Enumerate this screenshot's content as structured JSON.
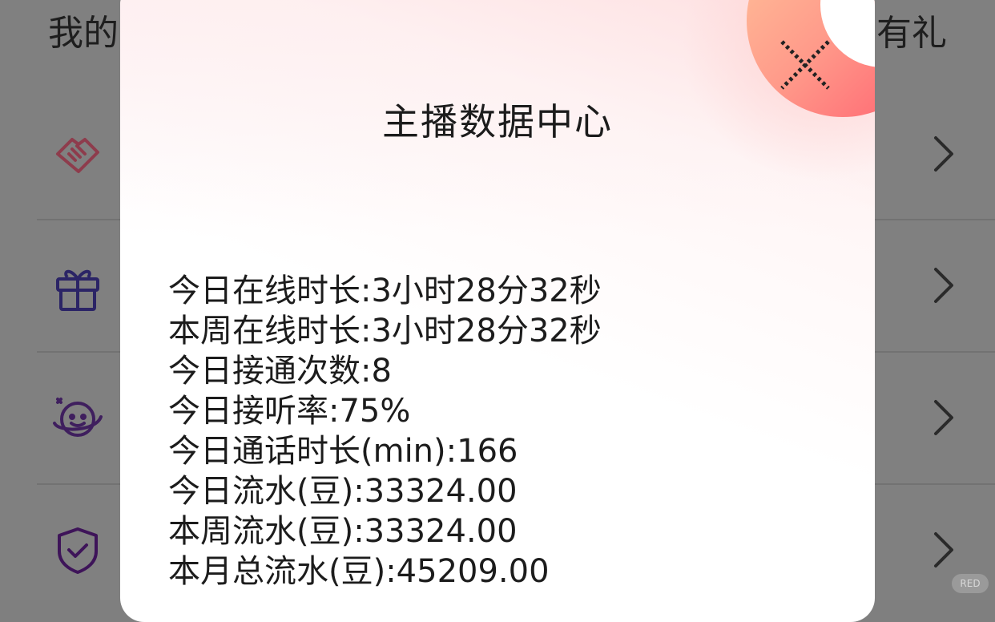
{
  "background_page": {
    "title_left": "我的",
    "title_right": "有礼",
    "rows": [
      {
        "icon": "handshake-icon",
        "color": "#d9526a"
      },
      {
        "icon": "gift-icon",
        "color": "#3b2f8f"
      },
      {
        "icon": "smiley-planet-icon",
        "color": "#5b2a86"
      },
      {
        "icon": "shield-check-icon",
        "color": "#5a1f7c"
      }
    ],
    "watermark": "小红书"
  },
  "dialog": {
    "title": "主播数据中心",
    "stats": [
      "今日在线时长:3小时28分32秒",
      "本周在线时长:3小时28分32秒",
      "今日接通次数:8",
      "今日接听率:75%",
      "今日通话时长(min):166",
      "今日流水(豆):33324.00",
      "本周流水(豆):33324.00",
      "本月总流水(豆):45209.00"
    ]
  },
  "colors": {
    "accent": "#ff6b6b",
    "overlay": "#808080"
  }
}
